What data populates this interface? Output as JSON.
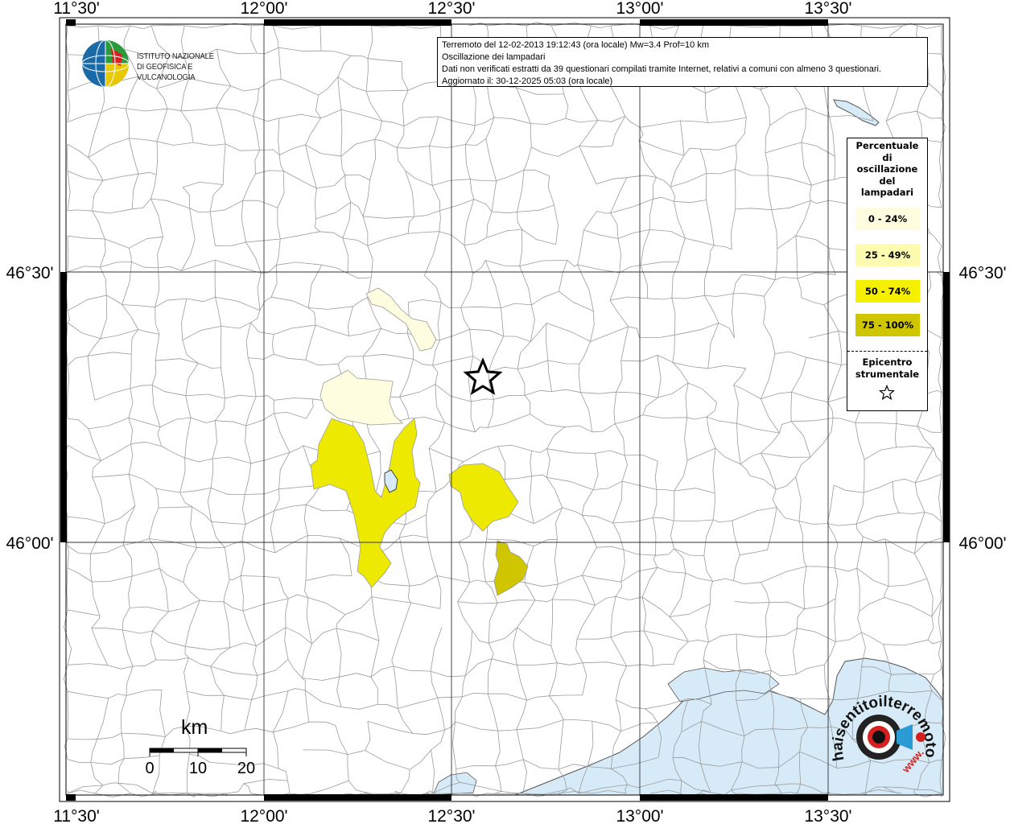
{
  "map": {
    "info": {
      "line1": "Terremoto del 12-02-2013 19:12:43 (ora locale) Mw=3.4 Prof=10 km",
      "line2": "Oscillazione dei lampadari",
      "line3": "Dati non verificati estratti da 39 questionari compilati tramite Internet, relativi a comuni con almeno 3 questionari.",
      "line4": "Aggiornato il: 30-12-2025 05:03 (ora locale)"
    },
    "axes": {
      "top_labels": [
        "11°30'",
        "12°00'",
        "12°30'",
        "13°00'",
        "13°30'"
      ],
      "bottom_labels": [
        "11°30'",
        "12°00'",
        "12°30'",
        "13°00'",
        "13°30'"
      ],
      "left_labels": [
        "46°30'",
        "46°00'"
      ],
      "right_labels": [
        "46°30'",
        "46°00'"
      ]
    },
    "institute_logo": {
      "line1": "ISTITUTO NAZIONALE",
      "line2": "DI GEOFISICA E VULCANOLOGIA"
    },
    "legend": {
      "title_lines": [
        "Percentuale",
        "di",
        "oscillazione",
        "del",
        "lampadari"
      ],
      "classes": [
        {
          "label": "0 - 24%",
          "color": "#fefde0"
        },
        {
          "label": "25 - 49%",
          "color": "#fdfbb0"
        },
        {
          "label": "50 - 74%",
          "color": "#f5f000"
        },
        {
          "label": "75 - 100%",
          "color": "#cfc600"
        }
      ],
      "epicenter_lines": [
        "Epicentro",
        "strumentale"
      ],
      "epicenter_icon": "star-icon"
    },
    "scalebar": {
      "unit": "km",
      "ticks": [
        "0",
        "10",
        "20"
      ]
    },
    "brand_logo": {
      "text": "haisentitoilterremoto.it",
      "prefix": "www."
    },
    "colors": {
      "sea": "#d6ebf7",
      "border_lines": "#9b9b9b",
      "grid": "#333333"
    }
  }
}
